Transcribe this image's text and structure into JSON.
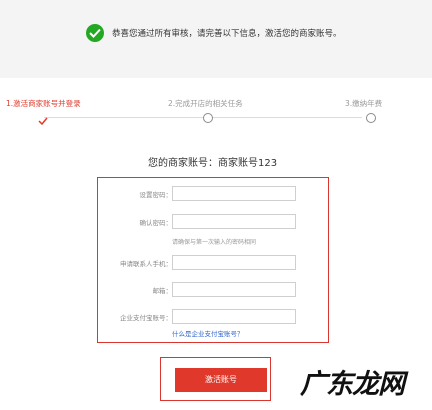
{
  "notice": {
    "text": "恭喜您通过所有审核，请完善以下信息，激活您的商家账号。"
  },
  "steps": [
    {
      "label": "1.激活商家账号并登录",
      "state": "active"
    },
    {
      "label": "2.完成开店的相关任务",
      "state": "pending"
    },
    {
      "label": "3.缴纳年费",
      "state": "pending"
    }
  ],
  "account": {
    "title": "您的商家账号：商家账号123"
  },
  "form": {
    "fields": [
      {
        "label": "设置密码：",
        "value": ""
      },
      {
        "label": "确认密码：",
        "value": ""
      },
      {
        "label": "申请联系人手机：",
        "value": ""
      },
      {
        "label": "邮箱：",
        "value": ""
      },
      {
        "label": "企业支付宝账号：",
        "value": ""
      }
    ],
    "hint": "请确保与第一次输入的密码相同",
    "alipay_link": "什么是企业支付宝账号？"
  },
  "activate_button": {
    "label": "激活账号"
  },
  "watermark": {
    "text": "广东龙网"
  },
  "colors": {
    "accent": "#e0392b",
    "success": "#22a822",
    "link": "#3366cc"
  }
}
